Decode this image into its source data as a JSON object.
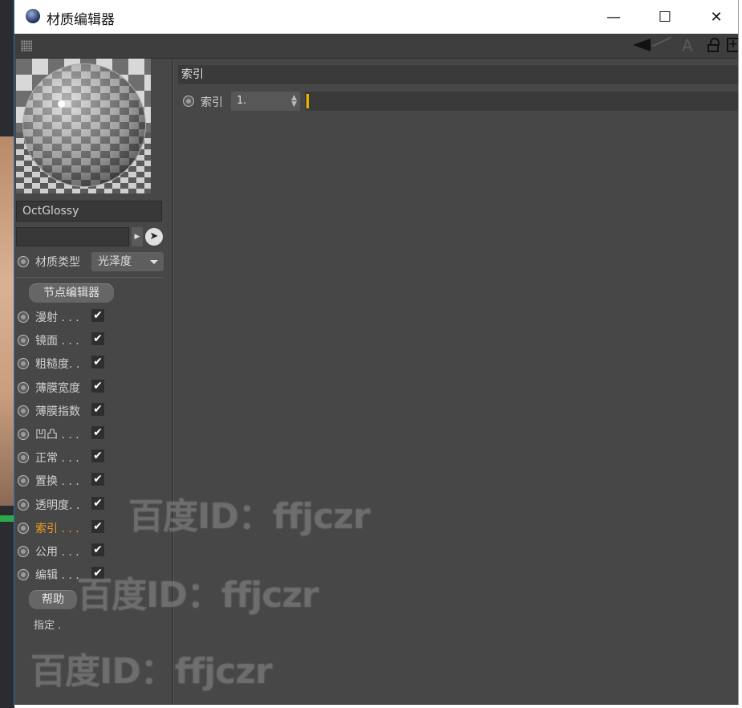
{
  "window": {
    "title": "材质编辑器",
    "controls": {
      "minimize": "—",
      "maximize": "☐",
      "close": "✕"
    }
  },
  "toolbar": {
    "icons": [
      "grip-icon",
      "back-arrow-icon",
      "forward-arrow-icon",
      "up-arrow-icon",
      "lock-icon",
      "new-window-icon"
    ]
  },
  "material": {
    "name": "OctGlossy",
    "type_label": "材质类型",
    "type_value": "光泽度",
    "node_editor_button": "节点编辑器",
    "help_button": "帮助",
    "assign_label": "指定 ."
  },
  "channels": [
    {
      "label": "漫射 . . .",
      "checked": "✔",
      "active": false
    },
    {
      "label": "镜面 . . .",
      "checked": "✔",
      "active": false
    },
    {
      "label": "粗糙度. .",
      "checked": "✔",
      "active": false
    },
    {
      "label": "薄膜宽度",
      "checked": "✔",
      "active": false
    },
    {
      "label": "薄膜指数",
      "checked": "✔",
      "active": false
    },
    {
      "label": "凹凸 . . .",
      "checked": "✔",
      "active": false
    },
    {
      "label": "正常 . . .",
      "checked": "✔",
      "active": false
    },
    {
      "label": "置换 . . .",
      "checked": "✔",
      "active": false
    },
    {
      "label": "透明度. .",
      "checked": "✔",
      "active": false
    },
    {
      "label": "索引 . . .",
      "checked": "✔",
      "active": true
    },
    {
      "label": "公用 . . .",
      "checked": "✔",
      "active": false
    },
    {
      "label": "编辑 . . .",
      "checked": "✔",
      "active": false
    }
  ],
  "index_section": {
    "header": "索引",
    "param_label": "索引",
    "value": "1.",
    "slider_level": 0.0
  },
  "watermarks": [
    "百度ID：ffjczr",
    "百度ID：ffjczr",
    "百度ID：ffjczr"
  ],
  "colors": {
    "panel": "#474747",
    "accent": "#f0b400",
    "active_label": "#f0a020"
  }
}
